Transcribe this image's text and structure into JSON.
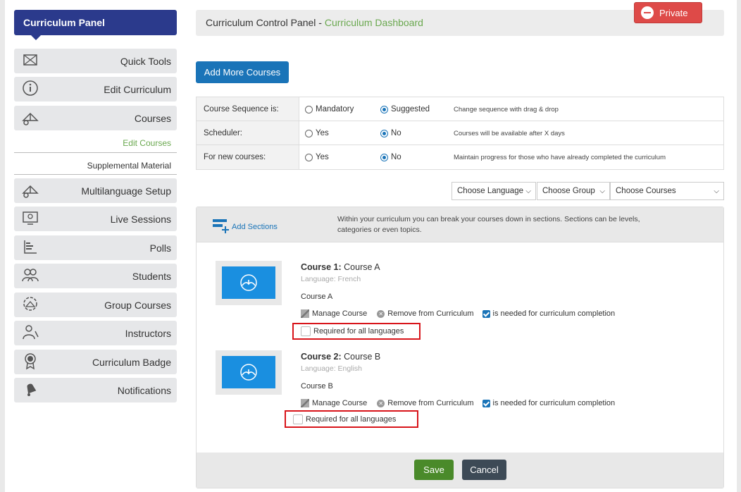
{
  "sidebar": {
    "title": "Curriculum Panel",
    "items": [
      {
        "label": "Quick Tools",
        "icon": "book-icon"
      },
      {
        "label": "Edit Curriculum",
        "icon": "info-icon"
      },
      {
        "label": "Courses",
        "icon": "courses-gear-icon"
      },
      {
        "label": "Multilanguage Setup",
        "icon": "multilanguage-icon"
      },
      {
        "label": "Live Sessions",
        "icon": "monitor-user-icon"
      },
      {
        "label": "Polls",
        "icon": "poll-bars-icon"
      },
      {
        "label": "Students",
        "icon": "students-icon"
      },
      {
        "label": "Group Courses",
        "icon": "group-courses-icon"
      },
      {
        "label": "Instructors",
        "icon": "instructor-icon"
      },
      {
        "label": "Curriculum Badge",
        "icon": "badge-icon"
      },
      {
        "label": "Notifications",
        "icon": "bell-icon"
      }
    ],
    "sub_items": {
      "edit_courses": "Edit Courses",
      "supplemental": "Supplemental Material"
    }
  },
  "header": {
    "title": "Curriculum Control Panel",
    "separator": " - ",
    "subtitle": "Curriculum Dashboard",
    "private_label": "Private"
  },
  "actions": {
    "add_more_courses": "Add More Courses"
  },
  "settings": {
    "rows": [
      {
        "label": "Course Sequence is:",
        "opt1": "Mandatory",
        "opt2": "Suggested",
        "selected": 2,
        "note": "Change sequence with drag & drop"
      },
      {
        "label": "Scheduler:",
        "opt1": "Yes",
        "opt2": "No",
        "selected": 2,
        "note": "Courses will be available after X days"
      },
      {
        "label": "For new courses:",
        "opt1": "Yes",
        "opt2": "No",
        "selected": 2,
        "note": "Maintain progress for those who have already completed the curriculum"
      }
    ]
  },
  "filters": {
    "language": "Choose Language",
    "group": "Choose Group",
    "courses": "Choose Courses"
  },
  "sections": {
    "add_label": "Add Sections",
    "description": "Within your curriculum you can break your courses down in sections. Sections can be levels, categories or even topics."
  },
  "courses": [
    {
      "prefix": "Course 1:",
      "name": "Course A",
      "language": "Language: French",
      "subname": "Course A",
      "manage": "Manage Course",
      "remove": "Remove from Curriculum",
      "needed": "is needed for curriculum completion",
      "required": "Required for all languages"
    },
    {
      "prefix": "Course 2:",
      "name": "Course B",
      "language": "Language: English",
      "subname": "Course B",
      "manage": "Manage Course",
      "remove": "Remove from Curriculum",
      "needed": "is needed for curriculum completion",
      "required": "Required for all languages"
    }
  ],
  "footer": {
    "save": "Save",
    "cancel": "Cancel"
  },
  "colors": {
    "primary": "#2b3a8c",
    "blue": "#1a74b8",
    "green": "#6aa84f",
    "danger": "#de4a48",
    "highlight": "#d8141a"
  }
}
